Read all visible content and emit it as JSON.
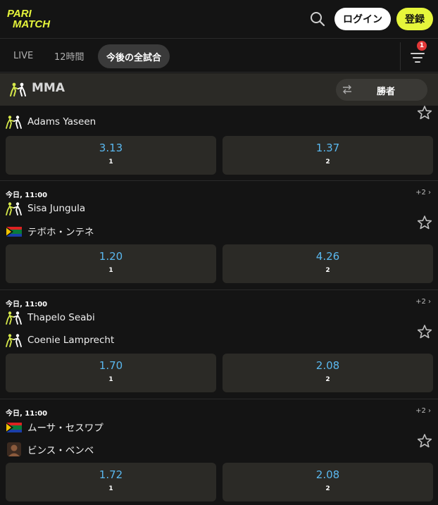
{
  "header": {
    "logo_line1": "PARI",
    "logo_line2": "MATCH",
    "login_label": "ログイン",
    "register_label": "登録"
  },
  "tabs": [
    {
      "label": "LIVE",
      "active": false
    },
    {
      "label": "12時間",
      "active": false
    },
    {
      "label": "今後の全試合",
      "active": true
    }
  ],
  "filter_badge": "1",
  "sport": {
    "title": "MMA",
    "market_label": "勝者"
  },
  "colors": {
    "accent": "#e6f53b",
    "odds": "#5ab8ef",
    "badge": "#e23838",
    "card": "#2b2a26"
  },
  "events": [
    {
      "time": "",
      "more": "",
      "teams": [
        {
          "name": "Adams Yaseen",
          "icon": "fighters-icon"
        }
      ],
      "odds": [
        {
          "value": "3.13",
          "label": "1"
        },
        {
          "value": "1.37",
          "label": "2"
        }
      ]
    },
    {
      "time": "今日, 11:00",
      "more": "+2 ›",
      "teams": [
        {
          "name": "Sisa Jungula",
          "icon": "fighters-icon"
        },
        {
          "name": "テボホ・ンテネ",
          "icon": "south-africa-flag-icon"
        }
      ],
      "odds": [
        {
          "value": "1.20",
          "label": "1"
        },
        {
          "value": "4.26",
          "label": "2"
        }
      ]
    },
    {
      "time": "今日, 11:00",
      "more": "+2 ›",
      "teams": [
        {
          "name": "Thapelo Seabi",
          "icon": "fighters-icon"
        },
        {
          "name": "Coenie Lamprecht",
          "icon": "fighters-icon"
        }
      ],
      "odds": [
        {
          "value": "1.70",
          "label": "1"
        },
        {
          "value": "2.08",
          "label": "2"
        }
      ]
    },
    {
      "time": "今日, 11:00",
      "more": "+2 ›",
      "teams": [
        {
          "name": "ムーサ・セスワプ",
          "icon": "south-africa-flag-icon"
        },
        {
          "name": "ビンス・ベンベ",
          "icon": "fighter-avatar-icon"
        }
      ],
      "odds": [
        {
          "value": "1.72",
          "label": "1"
        },
        {
          "value": "2.08",
          "label": "2"
        }
      ]
    }
  ]
}
